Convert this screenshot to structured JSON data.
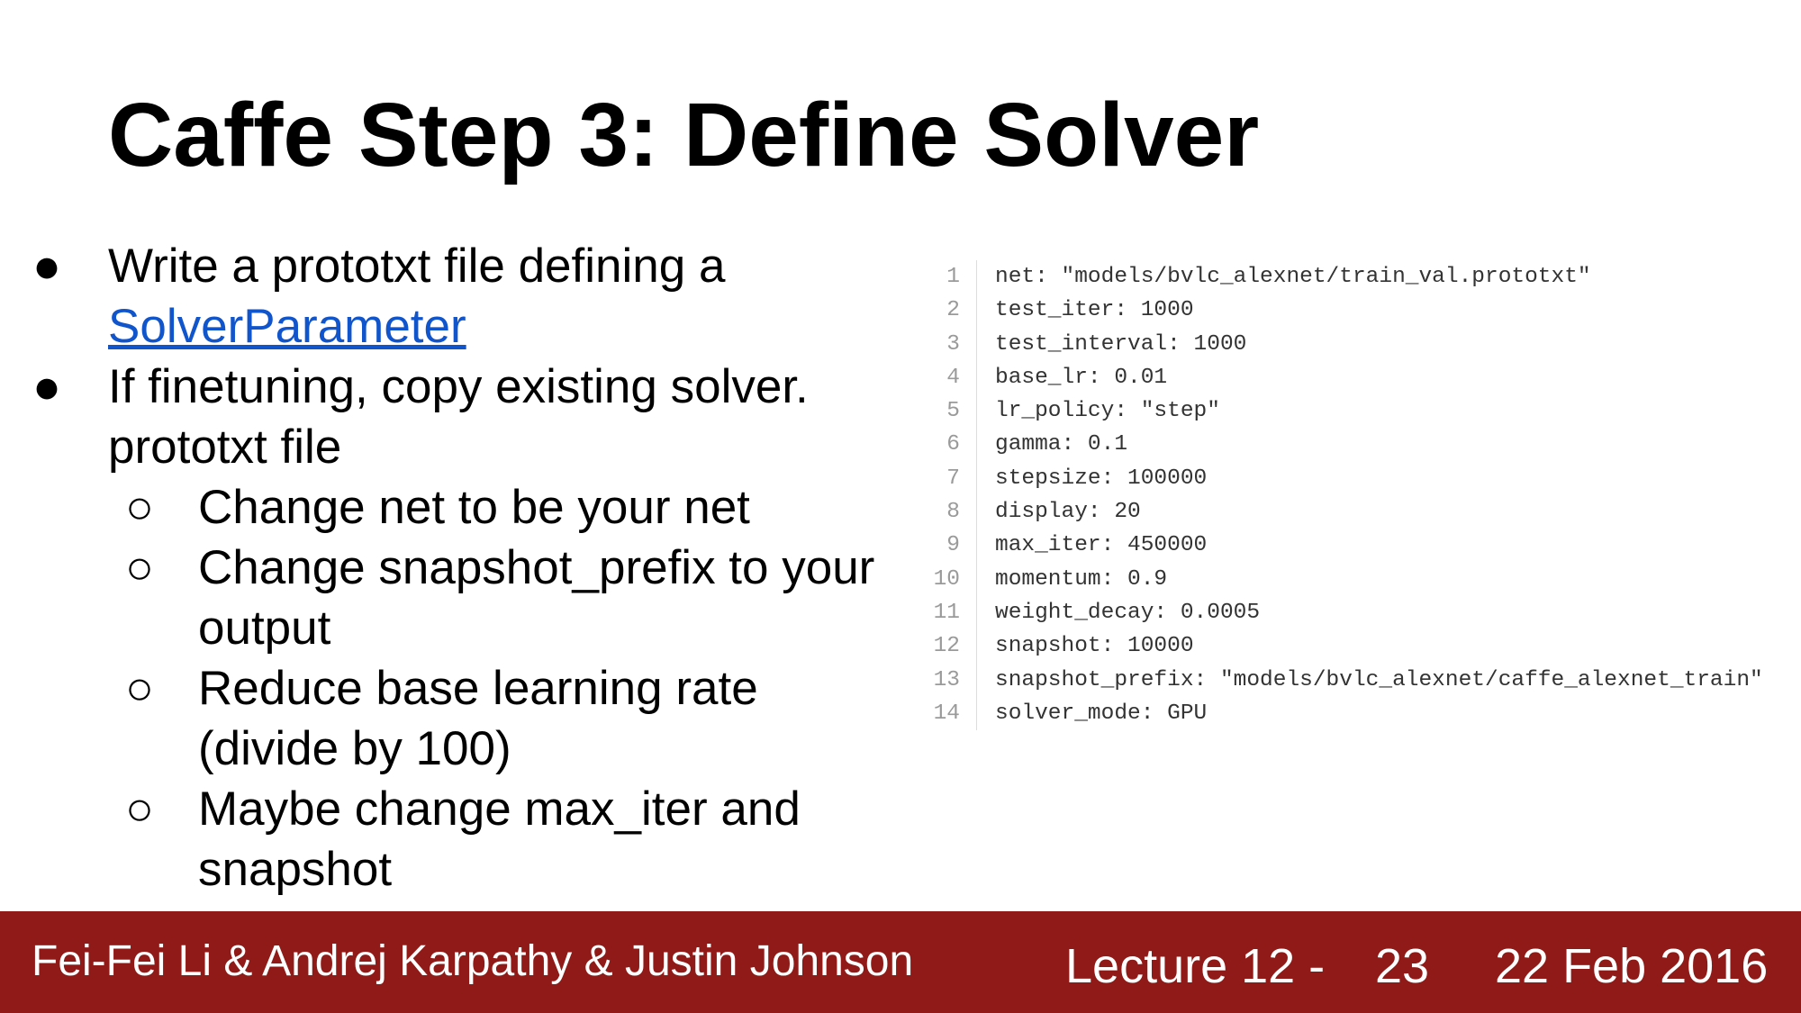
{
  "slide": {
    "title": "Caffe Step 3: Define Solver"
  },
  "bullets": [
    {
      "text": "Write a prototxt file defining a",
      "link": "SolverParameter"
    },
    {
      "text_line1": "If finetuning, copy existing solver.",
      "text_line2": "prototxt file"
    }
  ],
  "subbullets": [
    {
      "line1": "Change net to be your net"
    },
    {
      "line1": "Change snapshot_prefix to your",
      "line2": "output"
    },
    {
      "line1": "Reduce base learning rate",
      "line2": "(divide by 100)"
    },
    {
      "line1": "Maybe change max_iter and",
      "line2": "snapshot"
    }
  ],
  "markers": {
    "bullet": "●",
    "subbullet": "○"
  },
  "code": {
    "lines": [
      {
        "n": "1",
        "t": "net: \"models/bvlc_alexnet/train_val.prototxt\""
      },
      {
        "n": "2",
        "t": "test_iter: 1000"
      },
      {
        "n": "3",
        "t": "test_interval: 1000"
      },
      {
        "n": "4",
        "t": "base_lr: 0.01"
      },
      {
        "n": "5",
        "t": "lr_policy: \"step\""
      },
      {
        "n": "6",
        "t": "gamma: 0.1"
      },
      {
        "n": "7",
        "t": "stepsize: 100000"
      },
      {
        "n": "8",
        "t": "display: 20"
      },
      {
        "n": "9",
        "t": "max_iter: 450000"
      },
      {
        "n": "10",
        "t": "momentum: 0.9"
      },
      {
        "n": "11",
        "t": "weight_decay: 0.0005"
      },
      {
        "n": "12",
        "t": "snapshot: 10000"
      },
      {
        "n": "13",
        "t": "snapshot_prefix: \"models/bvlc_alexnet/caffe_alexnet_train\""
      },
      {
        "n": "14",
        "t": "solver_mode: GPU"
      }
    ]
  },
  "footer": {
    "authors": "Fei-Fei Li & Andrej Karpathy & Justin Johnson",
    "lecture": "Lecture 12 -",
    "page": "23",
    "date": "22 Feb 2016"
  },
  "colors": {
    "footer_bg": "#8f1a17",
    "link": "#1155cc"
  }
}
